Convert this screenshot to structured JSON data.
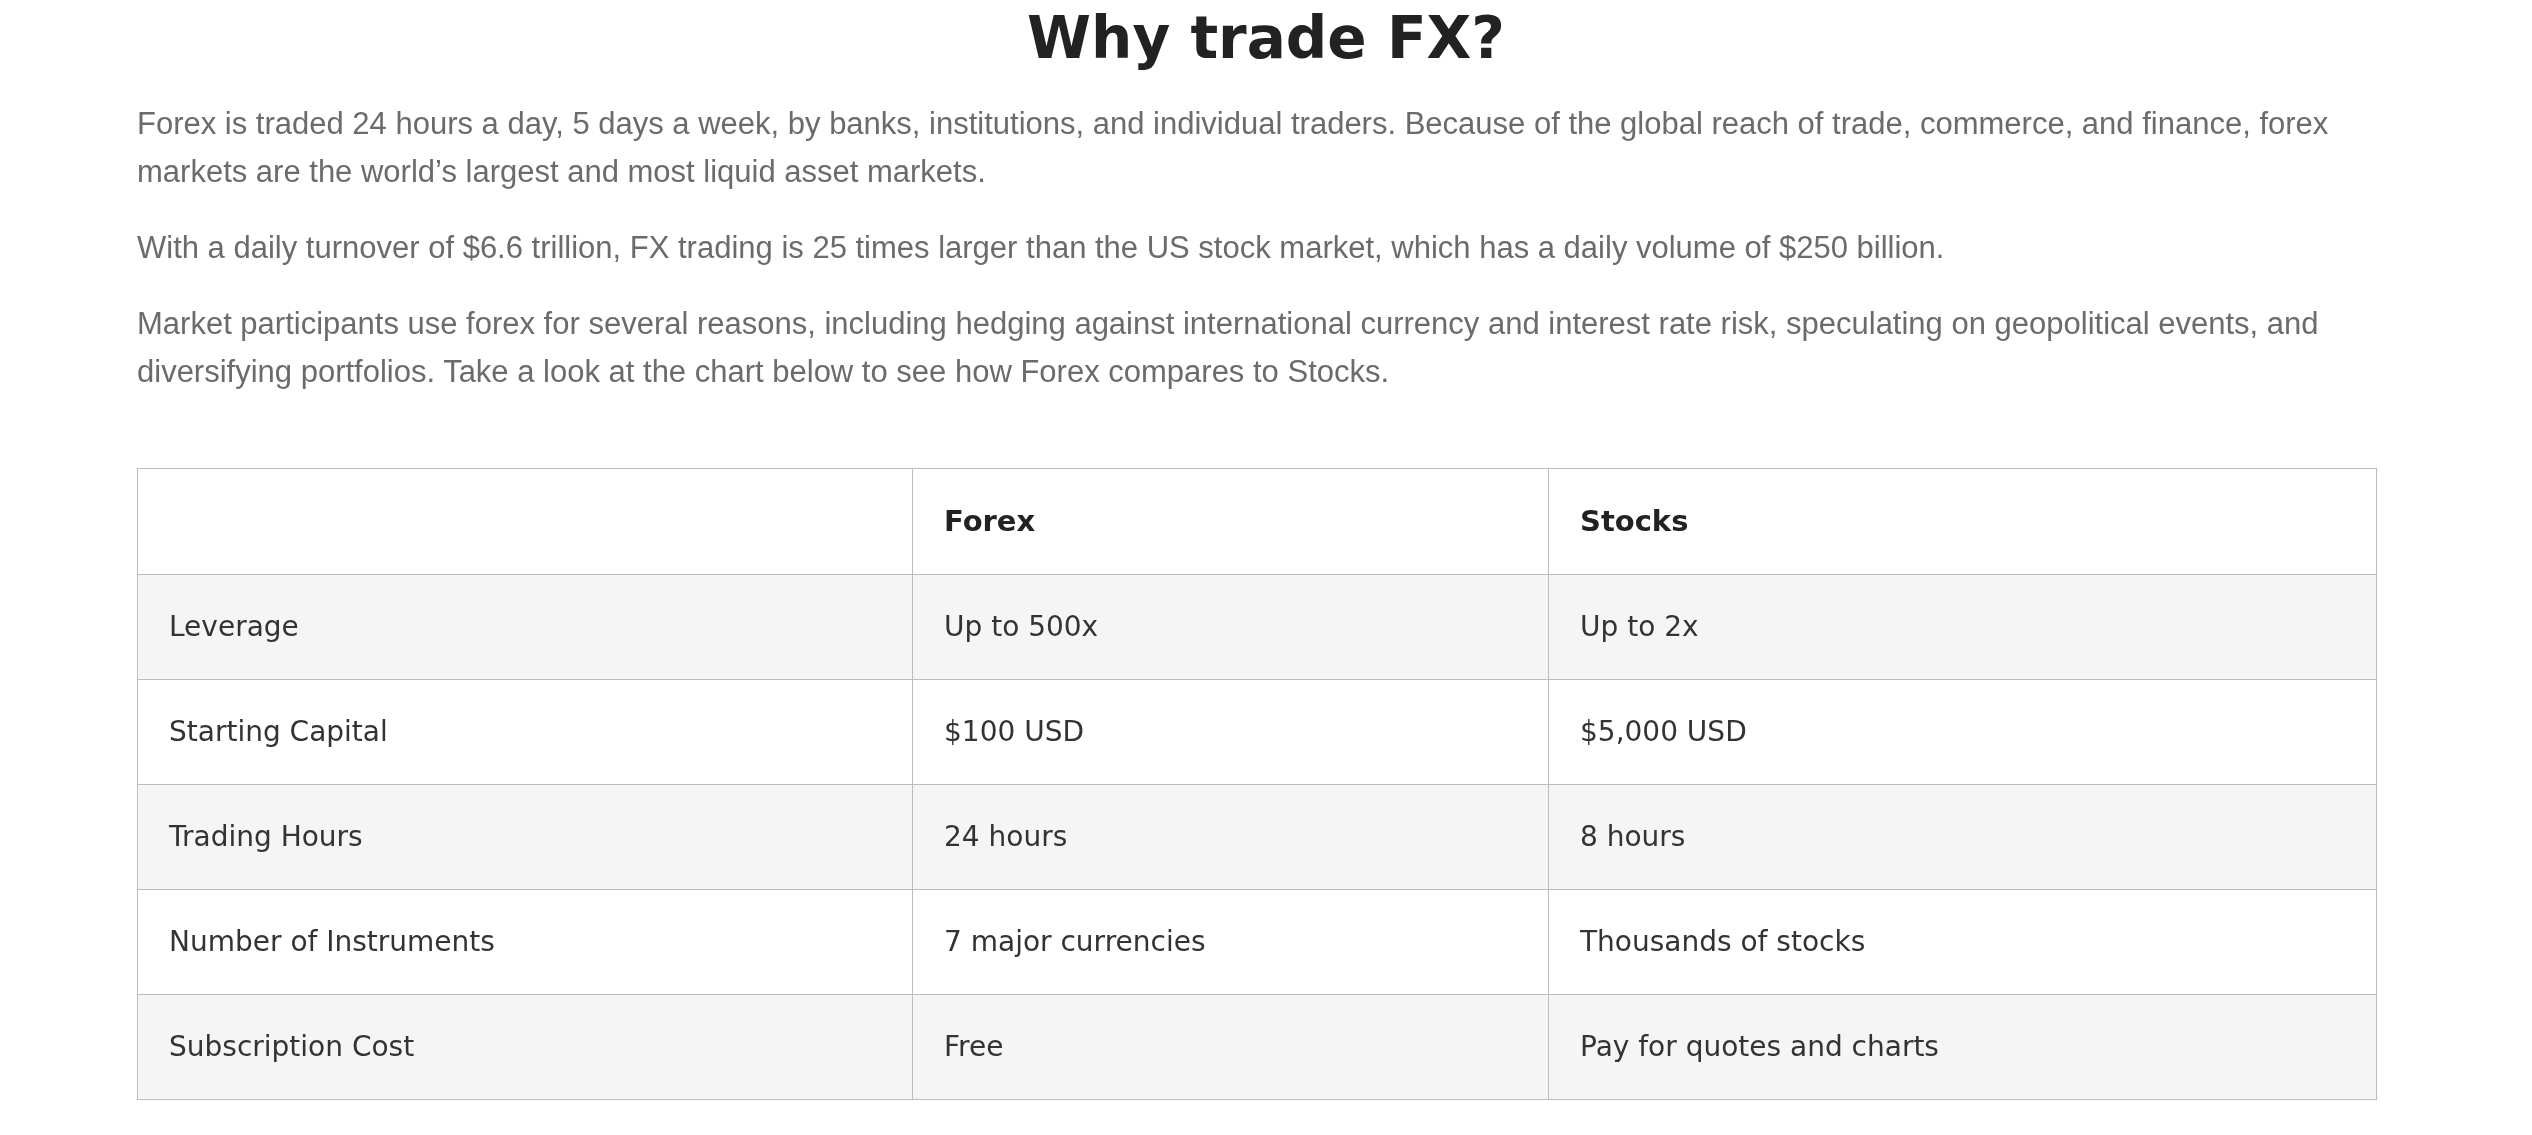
{
  "title": "Why trade FX?",
  "paragraphs": [
    "Forex is traded 24 hours a day, 5 days a week, by banks, institutions, and individual traders. Because of the global reach of trade, commerce, and finance, forex markets are the world’s largest and most liquid asset markets.",
    "With a daily turnover of $6.6 trillion, FX trading is 25 times larger than the US stock market, which has a daily volume of $250 billion.",
    "Market participants use forex for several reasons, including hedging against international currency and interest rate risk, speculating on geopolitical events, and diversifying portfolios. Take a look at the chart below to see how Forex compares to Stocks."
  ],
  "table": {
    "columns": [
      "",
      "Forex",
      "Stocks"
    ],
    "rows": [
      [
        "Leverage",
        "Up to 500x",
        "Up to 2x"
      ],
      [
        "Starting Capital",
        "$100 USD",
        "$5,000 USD"
      ],
      [
        "Trading Hours",
        "24 hours",
        "8 hours"
      ],
      [
        "Number of Instruments",
        "7 major currencies",
        "Thousands of stocks"
      ],
      [
        "Subscription Cost",
        "Free",
        "Pay for quotes and charts"
      ]
    ]
  }
}
